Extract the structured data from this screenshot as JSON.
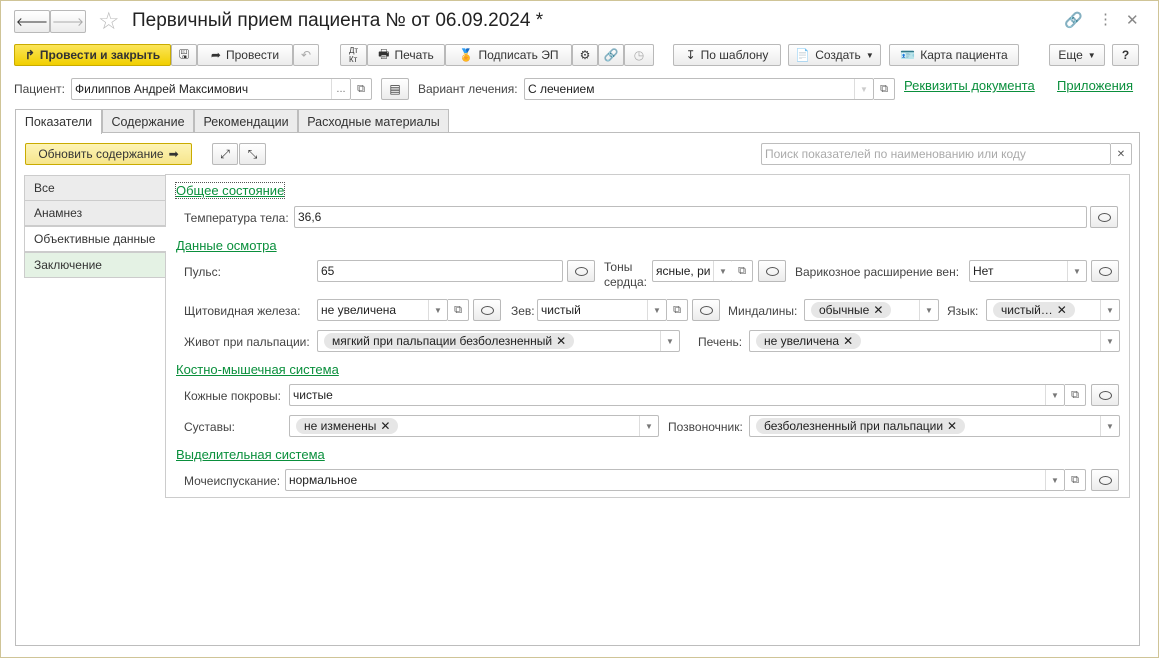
{
  "window": {
    "title": "Первичный прием пациента №  от 06.09.2024 *"
  },
  "toolbar": {
    "post_close": "Провести и закрыть",
    "post": "Провести",
    "print": "Печать",
    "sign": "Подписать ЭП",
    "by_template": "По шаблону",
    "create": "Создать",
    "patient_card": "Карта пациента",
    "more": "Еще",
    "help": "?"
  },
  "header": {
    "patient_label": "Пациент:",
    "patient_value": "Филиппов Андрей Максимович",
    "patient_select": "...",
    "variant_label": "Вариант лечения:",
    "variant_value": "С лечением",
    "link_requisites": "Реквизиты документа",
    "link_attachments": "Приложения"
  },
  "tabs": [
    "Показатели",
    "Содержание",
    "Рекомендации",
    "Расходные материалы"
  ],
  "panel": {
    "refresh": "Обновить содержание",
    "search_placeholder": "Поиск показателей по наименованию или коду"
  },
  "nav": [
    "Все",
    "Анамнез",
    "Объективные данные",
    "Заключение"
  ],
  "sections": {
    "general": {
      "title": "Общее состояние",
      "temp_label": "Температура тела:",
      "temp_value": "36,6"
    },
    "exam": {
      "title": "Данные осмотра",
      "pulse_label": "Пульс:",
      "pulse_value": "65",
      "heart_label1": "Тоны",
      "heart_label2": "сердца:",
      "heart_value": "ясные, ри",
      "varicose_label": "Варикозное расширение вен:",
      "varicose_value": "Нет",
      "thyroid_label": "Щитовидная железа:",
      "thyroid_value": "не увеличена",
      "throat_label": "Зев:",
      "throat_value": "чистый",
      "tonsils_label": "Миндалины:",
      "tonsils_tag": "обычные",
      "tongue_label": "Язык:",
      "tongue_tag": "чистый…",
      "abdomen_label": "Живот при пальпации:",
      "abdomen_tag": "мягкий при пальпации безболезненный",
      "liver_label": "Печень:",
      "liver_tag": "не увеличена"
    },
    "musculo": {
      "title": "Костно-мышечная система",
      "skin_label": "Кожные покровы:",
      "skin_value": "чистые",
      "joints_label": "Суставы:",
      "joints_tag": "не изменены",
      "spine_label": "Позвоночник:",
      "spine_tag": "безболезненный при пальпации"
    },
    "excretory": {
      "title": "Выделительная система",
      "urination_label": "Мочеиспускание:",
      "urination_value": "нормальное"
    }
  }
}
